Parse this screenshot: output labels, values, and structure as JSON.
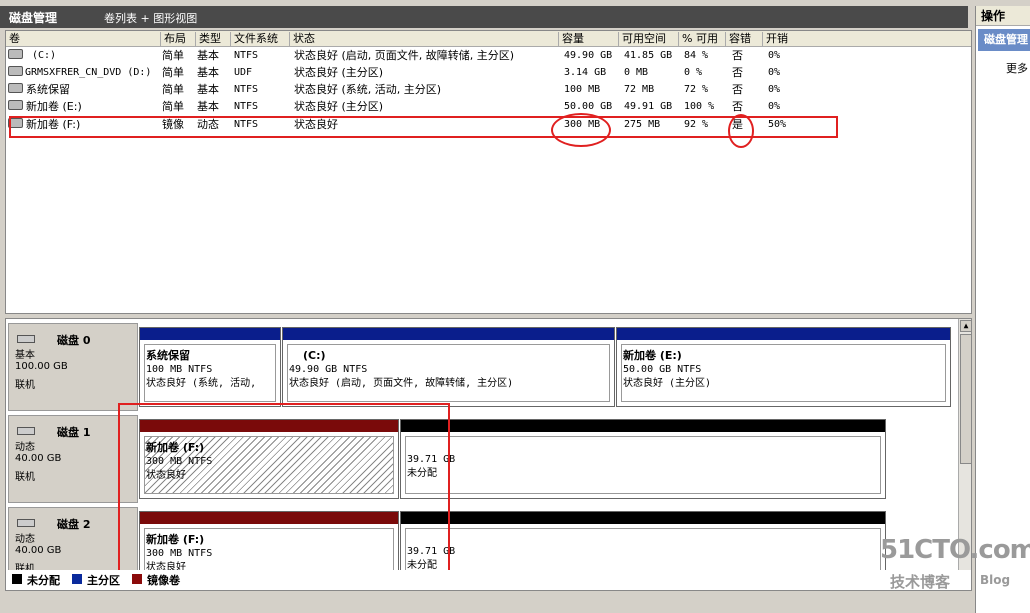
{
  "titlebar": {
    "title": "磁盘管理",
    "view_label": "卷列表 + 图形视图"
  },
  "actions": {
    "header": "操作",
    "selected": "磁盘管理",
    "more": "更多"
  },
  "columns": [
    "卷",
    "布局",
    "类型",
    "文件系统",
    "状态",
    "容量",
    "可用空间",
    "% 可用",
    "容错",
    "开销"
  ],
  "volumes": [
    {
      "name": "(C:)",
      "layout": "简单",
      "type": "基本",
      "fs": "NTFS",
      "status": "状态良好 (启动, 页面文件, 故障转储, 主分区)",
      "capacity": "49.90 GB",
      "free": "41.85 GB",
      "pct": "84 %",
      "fault": "否",
      "overhead": "0%"
    },
    {
      "name": "GRMSXFRER_CN_DVD (D:)",
      "layout": "简单",
      "type": "基本",
      "fs": "UDF",
      "status": "状态良好 (主分区)",
      "capacity": "3.14 GB",
      "free": "0 MB",
      "pct": "0 %",
      "fault": "否",
      "overhead": "0%"
    },
    {
      "name": "系统保留",
      "layout": "简单",
      "type": "基本",
      "fs": "NTFS",
      "status": "状态良好 (系统, 活动, 主分区)",
      "capacity": "100 MB",
      "free": "72 MB",
      "pct": "72 %",
      "fault": "否",
      "overhead": "0%"
    },
    {
      "name": "新加卷 (E:)",
      "layout": "简单",
      "type": "基本",
      "fs": "NTFS",
      "status": "状态良好 (主分区)",
      "capacity": "50.00 GB",
      "free": "49.91 GB",
      "pct": "100 %",
      "fault": "否",
      "overhead": "0%"
    },
    {
      "name": "新加卷 (F:)",
      "layout": "镜像",
      "type": "动态",
      "fs": "NTFS",
      "status": "状态良好",
      "capacity": "300 MB",
      "free": "275 MB",
      "pct": "92 %",
      "fault": "是",
      "overhead": "50%"
    }
  ],
  "disks": [
    {
      "name": "磁盘 0",
      "type": "基本",
      "size": "100.00 GB",
      "state": "联机",
      "partitions": [
        {
          "name": "系统保留",
          "size": "100 MB NTFS",
          "status": "状态良好 (系统, 活动,"
        },
        {
          "name": "(C:)",
          "size": "49.90 GB NTFS",
          "status": "状态良好 (启动, 页面文件, 故障转储, 主分区)"
        },
        {
          "name": "新加卷  (E:)",
          "size": "50.00 GB NTFS",
          "status": "状态良好 (主分区)"
        }
      ]
    },
    {
      "name": "磁盘 1",
      "type": "动态",
      "size": "40.00 GB",
      "state": "联机",
      "partitions": [
        {
          "name": "新加卷  (F:)",
          "size": "300 MB NTFS",
          "status": "状态良好"
        },
        {
          "name": "",
          "size": "39.71 GB",
          "status": "未分配"
        }
      ]
    },
    {
      "name": "磁盘 2",
      "type": "动态",
      "size": "40.00 GB",
      "state": "联机",
      "partitions": [
        {
          "name": "新加卷  (F:)",
          "size": "300 MB NTFS",
          "status": "状态良好"
        },
        {
          "name": "",
          "size": "39.71 GB",
          "status": "未分配"
        }
      ]
    }
  ],
  "legend": [
    {
      "label": "未分配",
      "color": "#000000"
    },
    {
      "label": "主分区",
      "color": "#0a2a9c"
    },
    {
      "label": "镜像卷",
      "color": "#8b0a0a"
    }
  ],
  "colors": {
    "primary_bar": "#0a1e8c",
    "mirror_bar": "#7a0a0a",
    "unalloc_bar": "#000000",
    "annotation": "#e02020"
  },
  "watermark": {
    "brand": "51CTO.com",
    "sub": "技术博客",
    "blog": "Blog"
  }
}
